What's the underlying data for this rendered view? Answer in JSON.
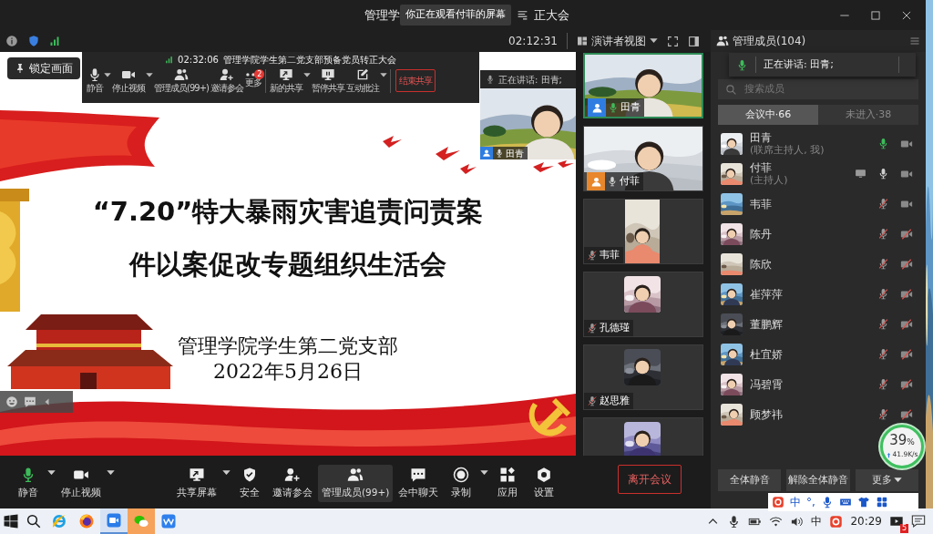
{
  "window": {
    "title_start": "管理学",
    "tooltip": "你正在观看付菲的屏幕",
    "title_end": "正大会"
  },
  "info_bar": {
    "timer": "02:12:31",
    "view_mode": "演讲者视图"
  },
  "lock_button": "锁定画面",
  "share_toolbar": {
    "timer": "02:32:06",
    "title": "管理学院学生第二党支部预备党员转正大会",
    "button_groups": [
      [
        {
          "label": "静音",
          "kind": "mic",
          "caret": true
        },
        {
          "label": "停止视频",
          "kind": "video",
          "caret": true
        },
        {
          "label": "管理成员(99+)",
          "kind": "people",
          "caret": false
        },
        {
          "label": "邀请参会",
          "kind": "invite",
          "caret": false
        },
        {
          "label": "更多",
          "kind": "more",
          "caret": false,
          "badge": "2"
        }
      ],
      [
        {
          "label": "新的共享",
          "kind": "share",
          "caret": true
        },
        {
          "label": "暂停共享",
          "kind": "pause",
          "caret": false
        },
        {
          "label": "互动批注",
          "kind": "pen",
          "caret": true
        }
      ]
    ],
    "end_button": "结束共享"
  },
  "speaker_preview": {
    "speaking": "正在讲话: 田青;",
    "name": "田青"
  },
  "slide": {
    "title_lines": [
      "“7.20”特大暴雨灾害追责问责案",
      "件以案促改专题组织生活会"
    ],
    "organization": "管理学院学生第二党支部",
    "date": "2022年5月26日"
  },
  "video_tiles": [
    {
      "name": "田青",
      "speaking": true,
      "muted": false,
      "color": "#2f7de1",
      "selected": true,
      "kind": "full"
    },
    {
      "name": "付菲",
      "speaking": false,
      "muted": false,
      "color": "#e8872b",
      "selected": false,
      "kind": "full"
    },
    {
      "name": "韦菲",
      "speaking": false,
      "muted": true,
      "selected": false,
      "kind": "portrait"
    },
    {
      "name": "孔德瑾",
      "speaking": false,
      "muted": true,
      "selected": false,
      "kind": "square"
    },
    {
      "name": "赵思雅",
      "speaking": false,
      "muted": true,
      "selected": false,
      "kind": "square"
    },
    {
      "selected": false,
      "kind": "partial"
    }
  ],
  "members_panel": {
    "title": "管理成员(104)",
    "speaking_popup": "正在讲话: 田青;",
    "search": {
      "placeholder": "搜索成员"
    },
    "tabs": [
      {
        "label": "会议中·66",
        "selected": true
      },
      {
        "label": "未进入·38",
        "selected": false
      }
    ],
    "members": [
      {
        "name": "田青",
        "note": "(联席主持人, 我)",
        "speaking": true,
        "muted": false,
        "video": true,
        "sharing": false
      },
      {
        "name": "付菲",
        "note": "(主持人)",
        "speaking": false,
        "muted": false,
        "video": true,
        "sharing": true
      },
      {
        "name": "韦菲",
        "speaking": false,
        "muted": true,
        "video": true,
        "sharing": false
      },
      {
        "name": "陈丹",
        "speaking": false,
        "muted": true,
        "video": false,
        "sharing": false
      },
      {
        "name": "陈欣",
        "speaking": false,
        "muted": true,
        "video": false,
        "sharing": false
      },
      {
        "name": "崔萍萍",
        "speaking": false,
        "muted": true,
        "video": false,
        "sharing": false
      },
      {
        "name": "董鹏辉",
        "speaking": false,
        "muted": true,
        "video": false,
        "sharing": false
      },
      {
        "name": "杜宜娇",
        "speaking": false,
        "muted": true,
        "video": false,
        "sharing": false
      },
      {
        "name": "冯碧霄",
        "speaking": false,
        "muted": true,
        "video": false,
        "sharing": false
      },
      {
        "name": "顾梦祎",
        "speaking": false,
        "muted": true,
        "video": false,
        "sharing": false
      }
    ],
    "buttons": [
      {
        "label": "全体静音",
        "caret": false
      },
      {
        "label": "解除全体静音",
        "caret": false
      },
      {
        "label": "更多",
        "caret": true
      }
    ]
  },
  "network": {
    "value": "39",
    "unit": "%",
    "speed": "41.9K/s"
  },
  "toolbar": {
    "groups": [
      [
        {
          "label": "静音",
          "kind": "mic",
          "caret": true,
          "selected": false
        },
        {
          "label": "停止视频",
          "kind": "video",
          "caret": true,
          "selected": false
        }
      ],
      [
        {
          "label": "共享屏幕",
          "kind": "share",
          "caret": true,
          "selected": false
        },
        {
          "label": "安全",
          "kind": "secure",
          "caret": false,
          "selected": false
        },
        {
          "label": "邀请参会",
          "kind": "invite",
          "caret": false,
          "selected": false
        },
        {
          "label": "管理成员(99+)",
          "kind": "people",
          "caret": false,
          "selected": true
        },
        {
          "label": "会中聊天",
          "kind": "chat",
          "caret": false,
          "selected": false
        },
        {
          "label": "录制",
          "kind": "record",
          "caret": true,
          "selected": false
        },
        {
          "label": "应用",
          "kind": "apps",
          "caret": false,
          "selected": false
        },
        {
          "label": "设置",
          "kind": "gear",
          "caret": false,
          "selected": false
        }
      ]
    ],
    "leave_button": "离开会议"
  },
  "ime": [
    {
      "kind": "logo"
    },
    {
      "kind": "text",
      "text": "中"
    },
    {
      "kind": "text",
      "text": "°,"
    },
    {
      "kind": "mic"
    },
    {
      "kind": "keyboard"
    },
    {
      "kind": "skin"
    },
    {
      "kind": "grid"
    }
  ],
  "taskbar": {
    "apps": [
      {
        "kind": "start",
        "active": false,
        "flashing": false
      },
      {
        "kind": "search",
        "active": false,
        "flashing": false
      },
      {
        "kind": "ie",
        "active": false,
        "flashing": false
      },
      {
        "kind": "firefox",
        "active": false,
        "flashing": false
      },
      {
        "kind": "meeting",
        "active": true,
        "flashing": false
      },
      {
        "kind": "wechat",
        "active": false,
        "flashing": true
      },
      {
        "kind": "docs",
        "active": false,
        "flashing": false
      }
    ],
    "tray": [
      {
        "kind": "chevron"
      },
      {
        "kind": "mic"
      },
      {
        "kind": "battery"
      },
      {
        "kind": "wifi"
      },
      {
        "kind": "volume"
      },
      {
        "kind": "text",
        "text": "中"
      },
      {
        "kind": "sogou"
      }
    ],
    "clock": "20:29",
    "notification_count": "5"
  }
}
